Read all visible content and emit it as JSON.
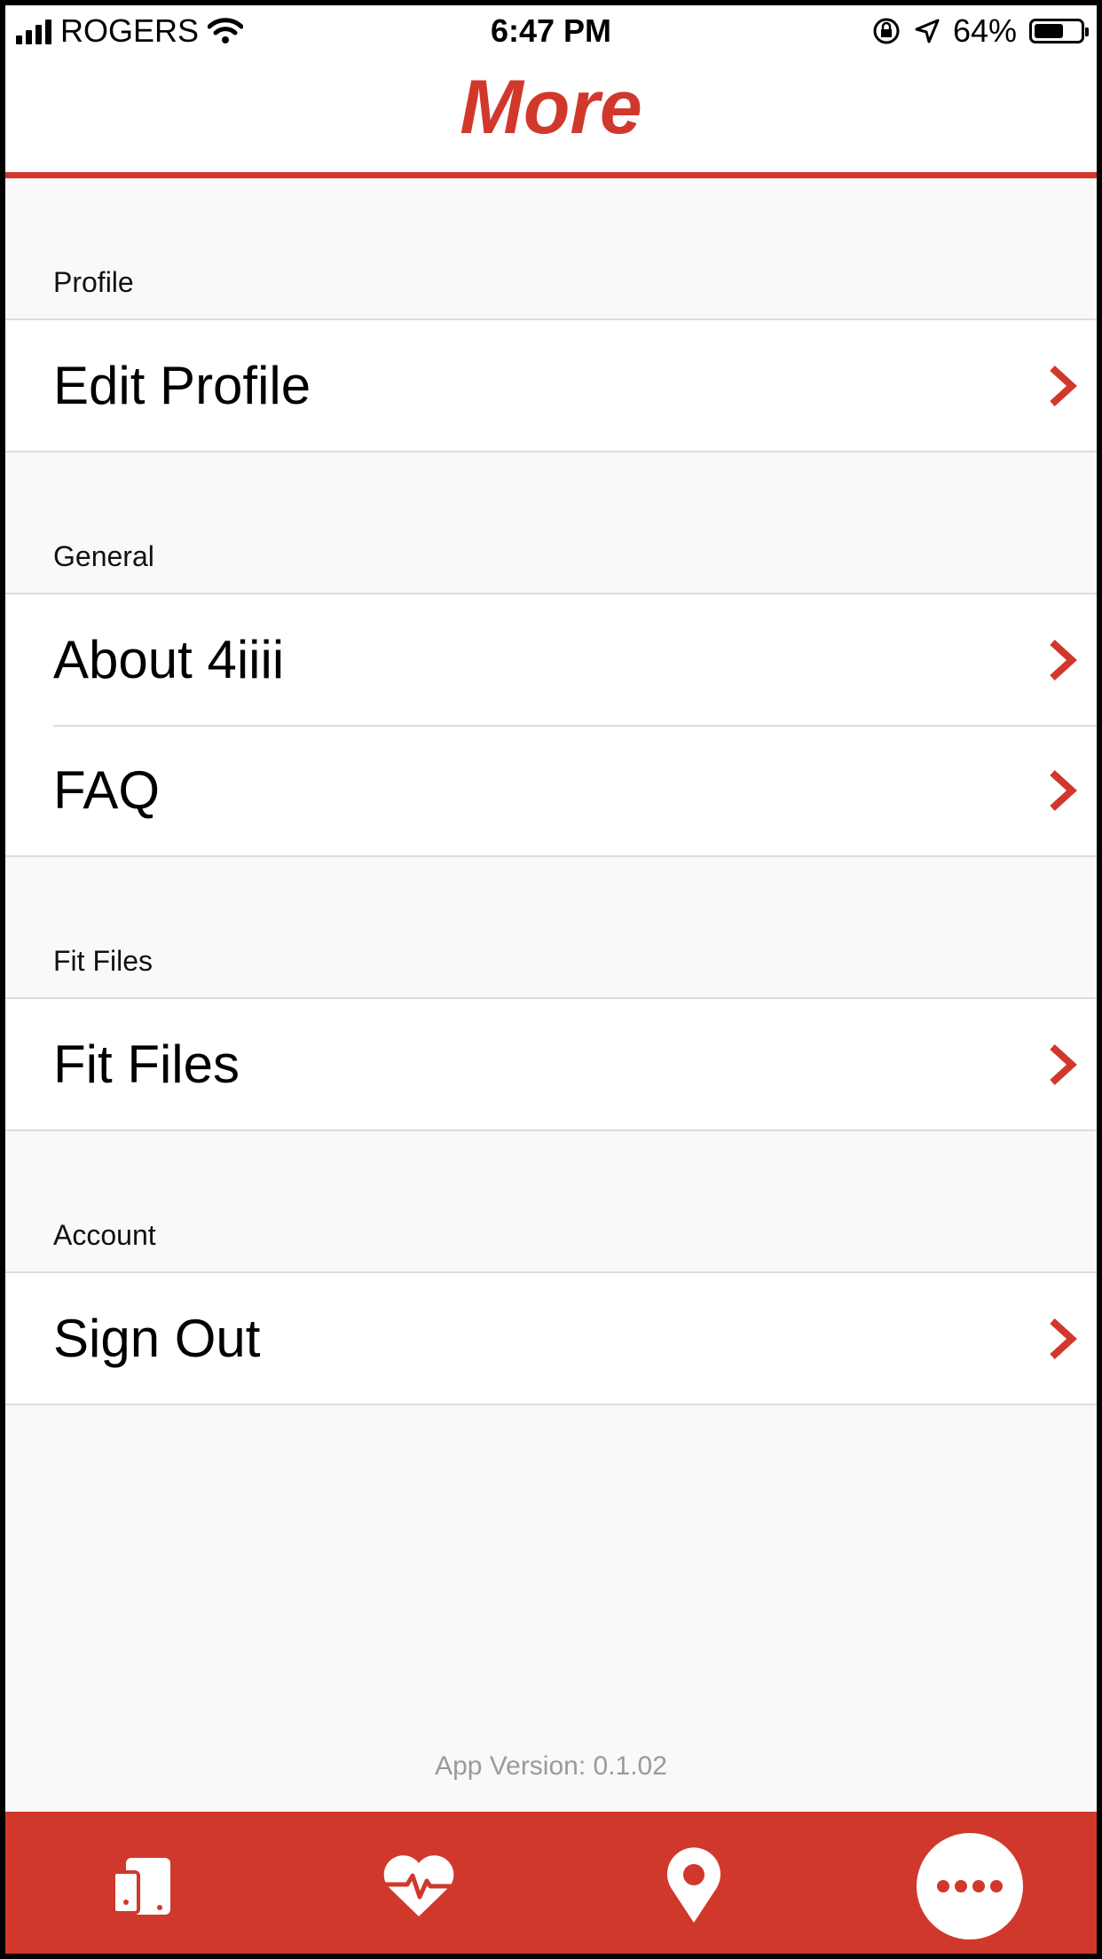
{
  "status_bar": {
    "carrier": "ROGERS",
    "time": "6:47 PM",
    "battery": "64%",
    "battery_level": 0.64
  },
  "header": {
    "title": "More"
  },
  "sections": [
    {
      "header": "Profile",
      "items": [
        {
          "label": "Edit Profile"
        }
      ]
    },
    {
      "header": "General",
      "items": [
        {
          "label": "About 4iiii"
        },
        {
          "label": "FAQ"
        }
      ]
    },
    {
      "header": "Fit Files",
      "items": [
        {
          "label": "Fit Files"
        }
      ]
    },
    {
      "header": "Account",
      "items": [
        {
          "label": "Sign Out"
        }
      ]
    }
  ],
  "footer": {
    "version": "App Version: 0.1.02"
  },
  "tabbar": {
    "tabs": [
      {
        "icon": "devices-icon"
      },
      {
        "icon": "heart-rate-icon"
      },
      {
        "icon": "location-pin-icon"
      },
      {
        "icon": "more-dots-icon",
        "selected": true
      }
    ]
  },
  "colors": {
    "accent": "#d1382c",
    "background": "#f9f9f9"
  }
}
